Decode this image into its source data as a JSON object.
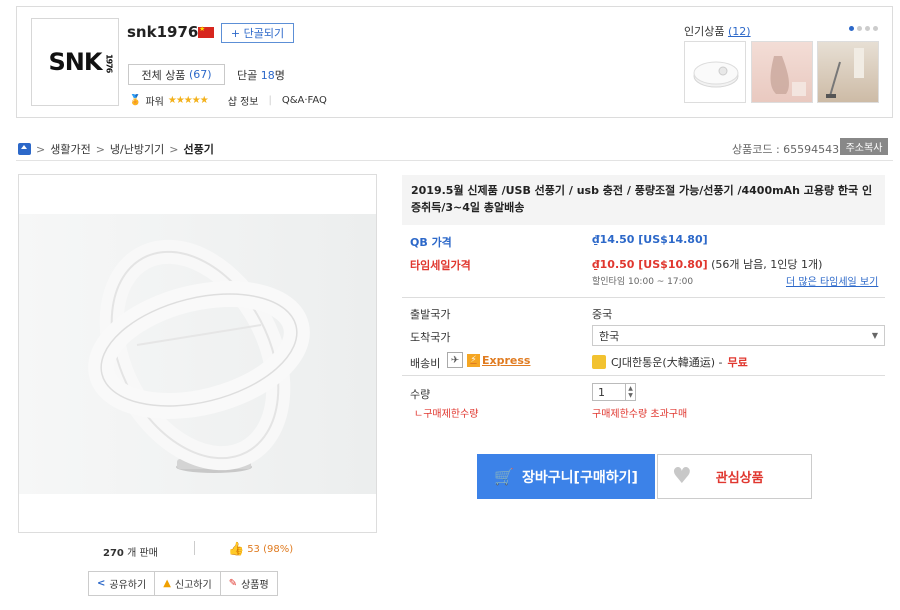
{
  "seller": {
    "logo_text": "SNK",
    "logo_year": "1976",
    "name": "snk1976",
    "fav_button": "+ 단골되기",
    "all_products_label": "전체 상품",
    "all_products_count": "(67)",
    "regulars_label": "단골",
    "regulars_count": "18",
    "regulars_unit": "명",
    "power_label": "파워",
    "stars": "★★★★★",
    "shop_info": "샵 정보",
    "qa_faq": "Q&A·FAQ"
  },
  "popular": {
    "label": "인기상품",
    "count": "(12)"
  },
  "breadcrumb": {
    "items": [
      "생활가전",
      "냉/난방기기",
      "선풍기"
    ]
  },
  "product_code": {
    "label": "상품코드 : 655945437",
    "copy_button": "주소복사"
  },
  "product": {
    "title": "2019.5월 신제품 /USB 선풍기 / usb 충전 / 풍량조절 가능/선풍기 /4400mAh 고용량 한국 인증취득/3~4일 총알배송",
    "qb_price_label": "QB 가격",
    "qb_price": "₫14.50 [US$14.80]",
    "time_sale_label": "타임세일가격",
    "time_sale_price": "₫10.50 [US$10.80]",
    "time_sale_note": "(56개 남음, 1인당 1개)",
    "time_sale_hours": "할인타임 10:00 ~ 17:00",
    "more_time_sale": "더 많은 타임세일 보기",
    "origin_label": "출발국가",
    "origin_value": "중국",
    "dest_label": "도착국가",
    "dest_value": "한국",
    "shipping_label": "배송비",
    "express_label": "Express",
    "courier": "CJ대한통운(大韓通运) -",
    "courier_fee": "무료",
    "qty_label": "수량",
    "qty_value": "1",
    "limit_label": "ㄴ구매제한수량",
    "limit_value": "구매제한수량 초과구매"
  },
  "buttons": {
    "cart": "장바구니[구매하기]",
    "wish": "관심상품"
  },
  "stats": {
    "sold_count": "270",
    "sold_unit": "개 판매",
    "likes": "53 (98%)"
  },
  "actions": {
    "share": "공유하기",
    "report": "신고하기",
    "review": "상품평"
  },
  "colors": {
    "accent_blue": "#3c82e8",
    "link_blue": "#2c68c9",
    "sale_red": "#e0372f",
    "star_gold": "#f3b11b"
  }
}
